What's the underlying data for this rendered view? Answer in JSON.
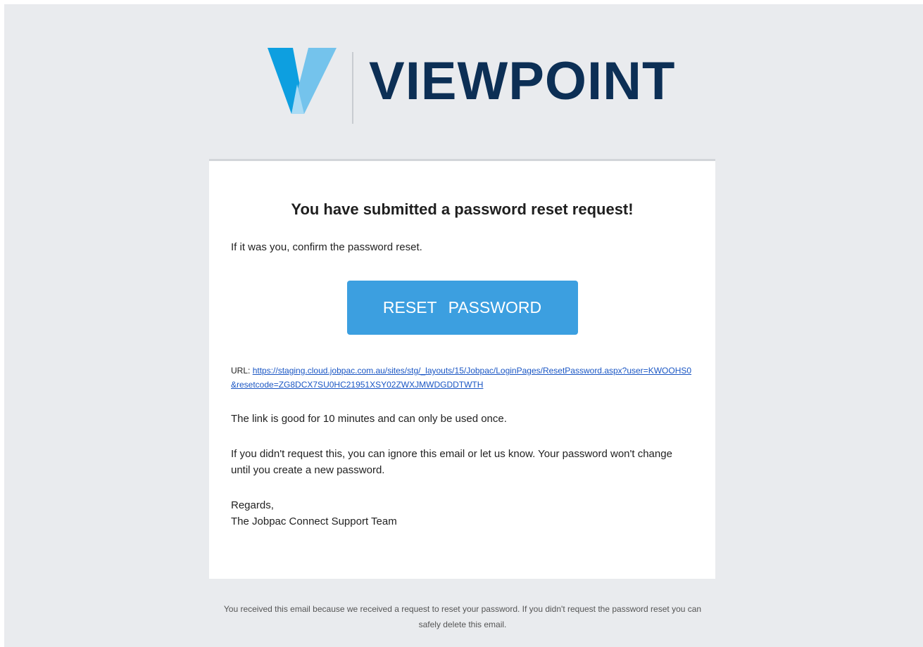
{
  "logo": {
    "wordmark": "VIEWPOINT",
    "colors": {
      "mark_primary": "#0d9fe0",
      "mark_secondary": "#74c3ec",
      "mark_light": "#a9dbf5",
      "wordmark": "#0c2f55"
    }
  },
  "email": {
    "title": "You have submitted a password reset request!",
    "intro": "If it was you, confirm the password reset.",
    "reset_button": "RESET PASSWORD",
    "url_label": "URL:",
    "url": "https://staging.cloud.jobpac.com.au/sites/stg/_layouts/15/Jobpac/LoginPages/ResetPassword.aspx?user=KWOOHS0&resetcode=ZG8DCX7SU0HC21951XSY02ZWXJMWDGDDTWTH",
    "validity": "The link is good for 10 minutes and can only be used once.",
    "ignore_notice": "If you didn't request this, you can ignore this email or let us know. Your password won't change until you create a new password.",
    "closing": "Regards,",
    "signature": "The Jobpac Connect Support Team"
  },
  "footer": {
    "text": "You received this email because we received a request to reset your password. If you didn't request the password reset you can safely delete this email."
  },
  "colors": {
    "background": "#e9ebee",
    "button": "#3c9fe0",
    "link": "#1a56c4"
  }
}
